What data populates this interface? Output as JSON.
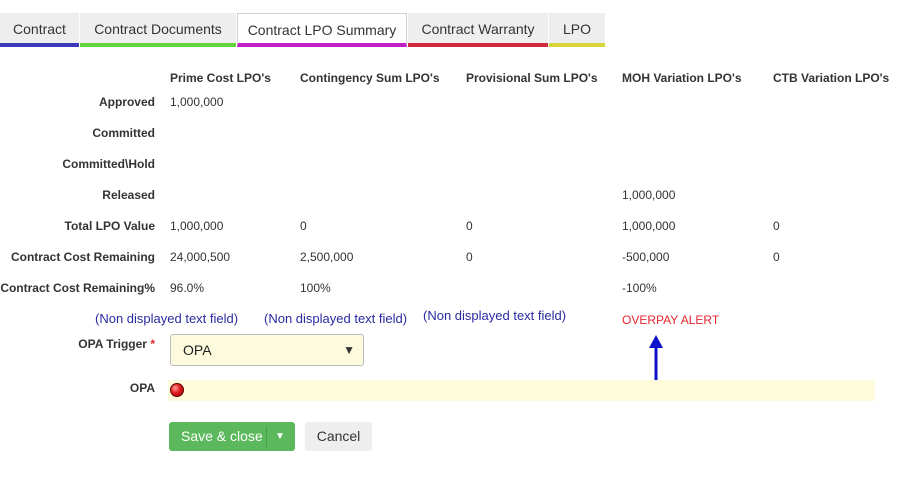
{
  "tabs": [
    {
      "label": "Contract",
      "color": "#3a3ab8",
      "active": false
    },
    {
      "label": "Contract Documents",
      "color": "#61d43e",
      "active": false
    },
    {
      "label": "Contract LPO Summary",
      "color": "#c21fc6",
      "active": true
    },
    {
      "label": "Contract Warranty",
      "color": "#cf2a3e",
      "active": false
    },
    {
      "label": "LPO",
      "color": "#d7d53a",
      "active": false
    }
  ],
  "columns": [
    "Prime Cost LPO's",
    "Contingency Sum LPO's",
    "Provisional Sum LPO's",
    "MOH Variation LPO's",
    "CTB Variation LPO's"
  ],
  "rows": [
    {
      "label": "Approved",
      "cells": [
        "1,000,000",
        "",
        "",
        "",
        ""
      ]
    },
    {
      "label": "Committed",
      "cells": [
        "",
        "",
        "",
        "",
        ""
      ]
    },
    {
      "label": "Committed\\Hold",
      "cells": [
        "",
        "",
        "",
        "",
        ""
      ]
    },
    {
      "label": "Released",
      "cells": [
        "",
        "",
        "",
        "1,000,000",
        ""
      ]
    },
    {
      "label": "Total LPO Value",
      "cells": [
        "1,000,000",
        "0",
        "0",
        "1,000,000",
        "0"
      ]
    },
    {
      "label": "Contract Cost Remaining",
      "cells": [
        "24,000,500",
        "2,500,000",
        "0",
        "-500,000",
        "0"
      ]
    },
    {
      "label": "Contract Cost Remaining%",
      "cells": [
        "96.0%",
        "100%",
        "",
        "-100%",
        ""
      ]
    }
  ],
  "non_displayed": [
    "(Non displayed text field)",
    "(Non displayed text field)",
    "(Non displayed text field)"
  ],
  "overpay_alert": "OVERPAY ALERT",
  "opa_trigger": {
    "label": "OPA Trigger",
    "required_mark": "*",
    "value": "OPA"
  },
  "opa": {
    "label": "OPA",
    "status_color": "red"
  },
  "buttons": {
    "save": "Save & close",
    "cancel": "Cancel"
  },
  "colors": {
    "save_green": "#5cb85c",
    "alert_red": "#e3262e",
    "annotation_blue": "#1010c8",
    "field_yellow": "#fdfbdd"
  }
}
